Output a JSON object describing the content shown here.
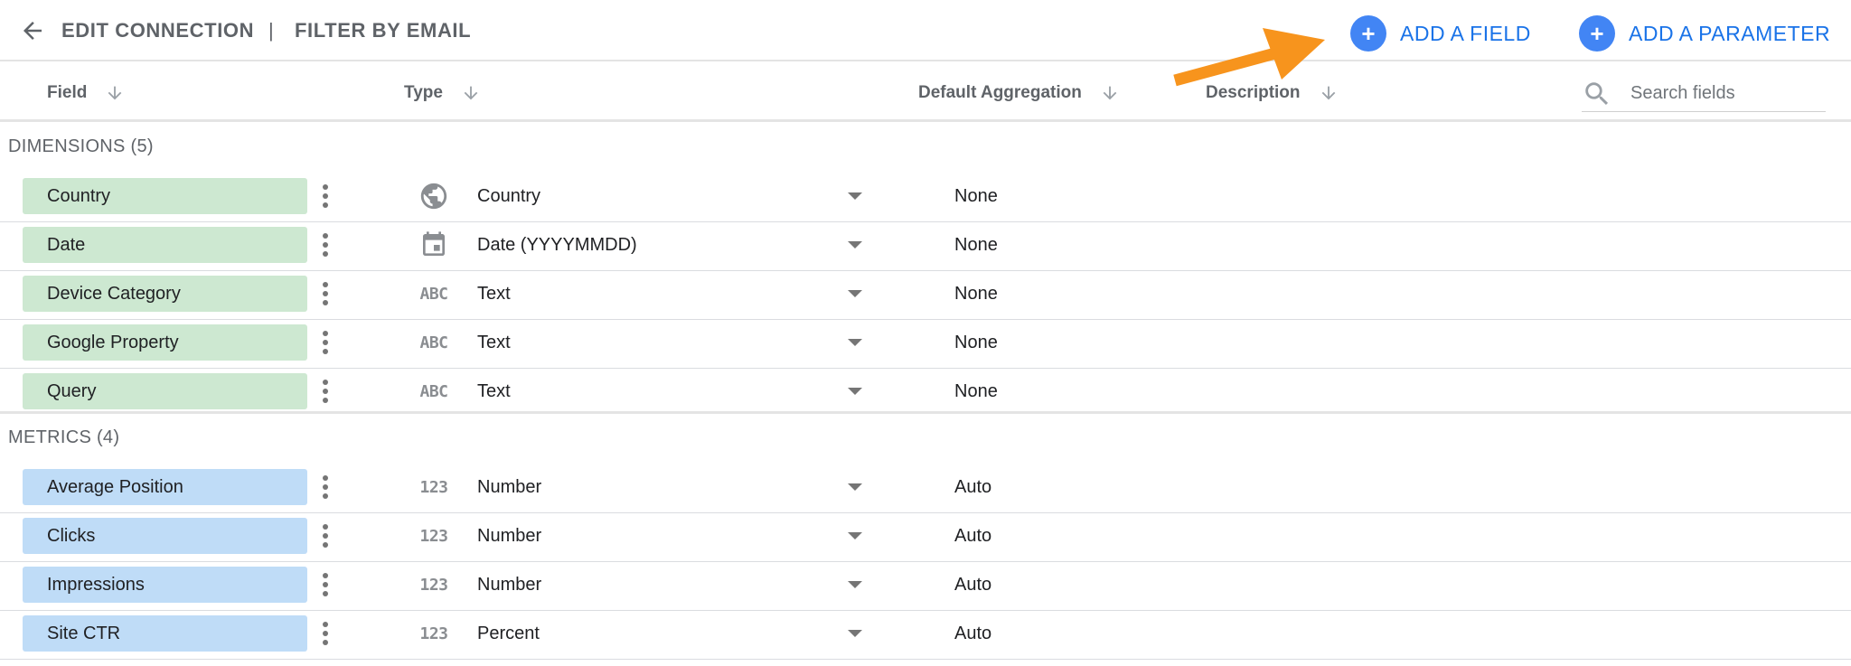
{
  "toolbar": {
    "back_icon": "arrow-left-icon",
    "crumb_1": "EDIT CONNECTION",
    "separator": "|",
    "crumb_2": "FILTER BY EMAIL",
    "add_field_label": "ADD A FIELD",
    "add_parameter_label": "ADD A PARAMETER",
    "add_symbol": "+"
  },
  "columns": {
    "field": "Field",
    "type": "Type",
    "default_aggregation": "Default Aggregation",
    "description": "Description"
  },
  "search": {
    "placeholder": "Search fields",
    "value": ""
  },
  "sections": {
    "dimensions_label": "DIMENSIONS (5)",
    "metrics_label": "METRICS (4)"
  },
  "dimensions": [
    {
      "name": "Country",
      "type_icon": "globe-icon",
      "type_label": "Country",
      "aggregation": "None"
    },
    {
      "name": "Date",
      "type_icon": "calendar-icon",
      "type_label": "Date (YYYYMMDD)",
      "aggregation": "None"
    },
    {
      "name": "Device Category",
      "type_icon": "text-type-icon",
      "type_icon_text": "ABC",
      "type_label": "Text",
      "aggregation": "None"
    },
    {
      "name": "Google Property",
      "type_icon": "text-type-icon",
      "type_icon_text": "ABC",
      "type_label": "Text",
      "aggregation": "None"
    },
    {
      "name": "Query",
      "type_icon": "text-type-icon",
      "type_icon_text": "ABC",
      "type_label": "Text",
      "aggregation": "None"
    }
  ],
  "metrics": [
    {
      "name": "Average Position",
      "type_icon": "number-type-icon",
      "type_icon_text": "123",
      "type_label": "Number",
      "aggregation": "Auto"
    },
    {
      "name": "Clicks",
      "type_icon": "number-type-icon",
      "type_icon_text": "123",
      "type_label": "Number",
      "aggregation": "Auto"
    },
    {
      "name": "Impressions",
      "type_icon": "number-type-icon",
      "type_icon_text": "123",
      "type_label": "Number",
      "aggregation": "Auto"
    },
    {
      "name": "Site CTR",
      "type_icon": "number-type-icon",
      "type_icon_text": "123",
      "type_label": "Percent",
      "aggregation": "Auto"
    }
  ],
  "colors": {
    "dimension_chip": "#cde8d1",
    "metric_chip": "#bfdcf7",
    "accent_blue": "#4285f4",
    "link_blue": "#1a73e8",
    "callout_orange": "#f7941d"
  }
}
